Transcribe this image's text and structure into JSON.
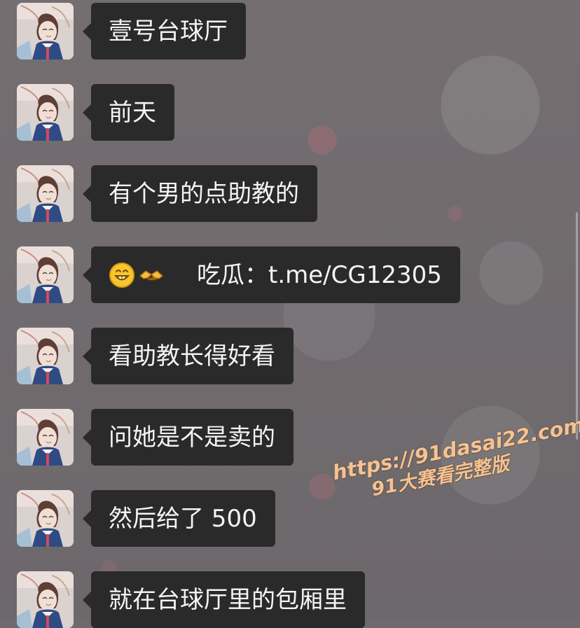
{
  "messages": [
    {
      "text": "壹号台球厅",
      "avatar_icon": "user-avatar-icon"
    },
    {
      "text": "前天",
      "avatar_icon": "user-avatar-icon"
    },
    {
      "text": "有个男的点助教的",
      "avatar_icon": "user-avatar-icon"
    },
    {
      "text": "吃瓜：t.me/CG12305",
      "avatar_icon": "user-avatar-icon",
      "emoji_icons": [
        "grinning-face-icon",
        "handshake-icon"
      ]
    },
    {
      "text": "看助教长得好看",
      "avatar_icon": "user-avatar-icon"
    },
    {
      "text": "问她是不是卖的",
      "avatar_icon": "user-avatar-icon"
    },
    {
      "text": "然后给了 500",
      "avatar_icon": "user-avatar-icon"
    },
    {
      "text": "就在台球厅里的包厢里",
      "avatar_icon": "user-avatar-icon"
    }
  ],
  "watermark": {
    "line1": "https://91dasai22.com",
    "line2": "91大赛看完整版"
  },
  "colors": {
    "background": "#6f6a6d",
    "bubble": "#2b2a2b",
    "text": "#f4f4f4",
    "watermark": "#f5c291"
  }
}
